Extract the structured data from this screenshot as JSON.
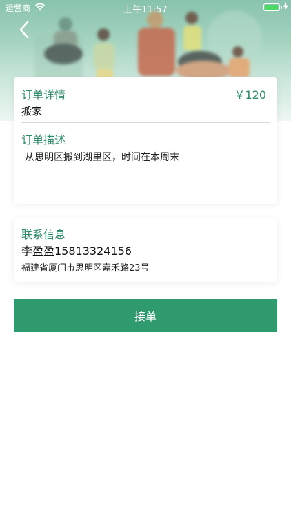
{
  "status_bar": {
    "carrier": "运营商",
    "time": "上午11:57",
    "battery_level": 0.95
  },
  "order": {
    "title": "订单详情",
    "price": "￥120",
    "name": "搬家",
    "desc_title": "订单描述",
    "description": "从思明区搬到湖里区，时间在本周末"
  },
  "contact": {
    "title": "联系信息",
    "name_phone": "李盈盈15813324156",
    "address": "福建省厦门市思明区嘉禾路23号"
  },
  "actions": {
    "accept_label": "接单"
  },
  "colors": {
    "accent": "#2e8b67",
    "button": "#2f9a6e"
  },
  "icons": {
    "back": "chevron-left-icon",
    "wifi": "wifi-icon",
    "battery": "battery-icon",
    "charging": "charging-bolt-icon"
  }
}
